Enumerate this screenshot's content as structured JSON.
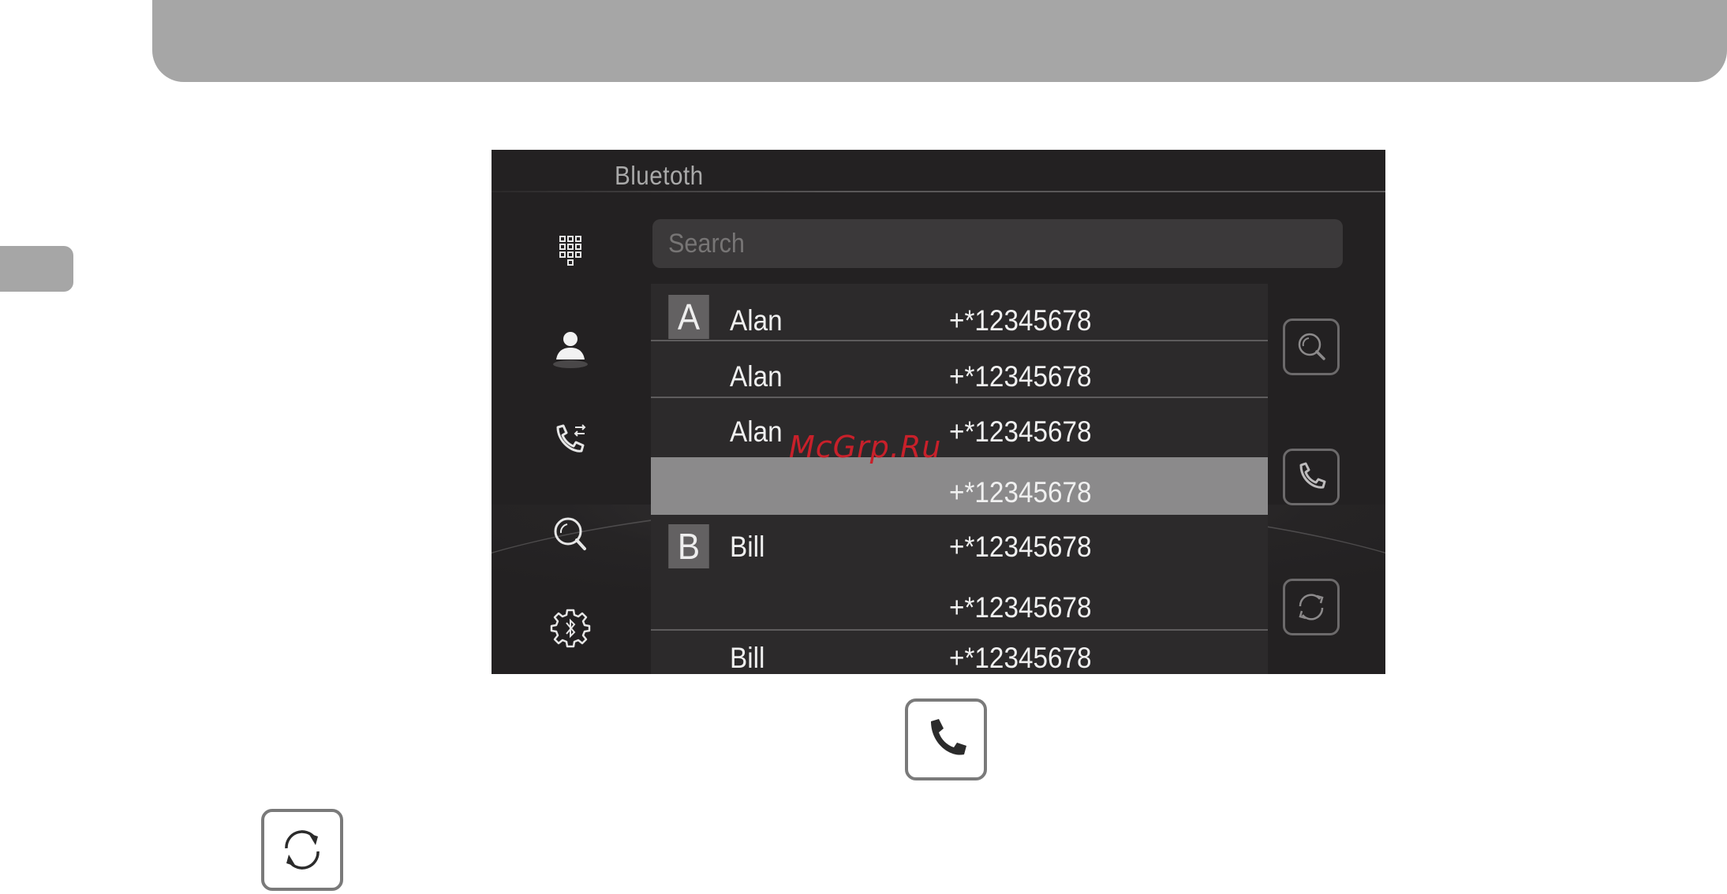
{
  "screen": {
    "title": "Bluetoth",
    "search": {
      "placeholder": "Search"
    }
  },
  "nav": [
    {
      "name": "dialpad-icon",
      "active": false
    },
    {
      "name": "contacts-icon",
      "active": true
    },
    {
      "name": "call-history-icon",
      "active": false
    },
    {
      "name": "search-icon",
      "active": false
    },
    {
      "name": "bluetooth-settings-icon",
      "active": false
    }
  ],
  "contacts": [
    {
      "letter": "A",
      "name": "Alan",
      "number": "+*12345678"
    },
    {
      "letter": "",
      "name": "Alan",
      "number": "+*12345678"
    },
    {
      "letter": "",
      "name": "Alan",
      "number": "+*12345678"
    },
    {
      "letter": "",
      "name": "",
      "number": "+*12345678",
      "selected": true
    },
    {
      "letter": "B",
      "name": "Bill",
      "number": "+*12345678"
    },
    {
      "letter": "",
      "name": "",
      "number": "+*12345678"
    },
    {
      "letter": "",
      "name": "Bill",
      "number": "+*12345678"
    }
  ],
  "side_buttons": [
    "search-icon",
    "phone-icon",
    "sync-icon"
  ],
  "watermark": "McGrp.Ru",
  "legend_icons": [
    "phone-icon",
    "sync-icon"
  ],
  "colors": {
    "band": "#a6a6a6",
    "screen_bg": "#232122",
    "selected_row": "#8b8a8b"
  }
}
